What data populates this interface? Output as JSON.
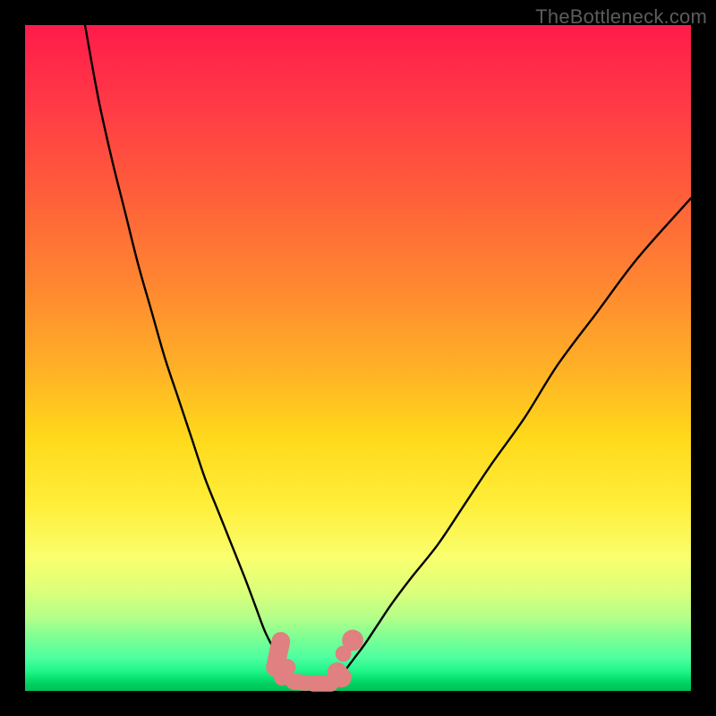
{
  "watermark": "TheBottleneck.com",
  "colors": {
    "frame": "#000000",
    "curve": "#000000",
    "marker_fill": "#e08080",
    "marker_stroke": "#c96a6a"
  },
  "chart_data": {
    "type": "line",
    "title": "",
    "xlabel": "",
    "ylabel": "",
    "xlim": [
      0,
      100
    ],
    "ylim": [
      0,
      100
    ],
    "grid": false,
    "legend": false,
    "series": [
      {
        "name": "left-curve",
        "x": [
          9,
          11,
          13,
          15,
          17,
          19,
          21,
          23,
          25,
          27,
          29,
          31,
          33,
          34.5,
          36,
          37.5,
          39
        ],
        "values": [
          100,
          89,
          80,
          72,
          64,
          57,
          50,
          44,
          38,
          32,
          27,
          22,
          17,
          13,
          9,
          6,
          3
        ]
      },
      {
        "name": "right-curve",
        "x": [
          48,
          49.5,
          51,
          53,
          55,
          58,
          62,
          66,
          70,
          75,
          80,
          86,
          92,
          100
        ],
        "values": [
          3,
          5,
          7,
          10,
          13,
          17,
          22,
          28,
          34,
          41,
          49,
          57,
          65,
          74
        ]
      },
      {
        "name": "bottom-connector",
        "x": [
          38,
          40,
          42,
          44,
          46,
          48
        ],
        "values": [
          2,
          1,
          0.8,
          0.8,
          1,
          2
        ]
      }
    ],
    "markers": [
      {
        "shape": "pill",
        "cx": 38.0,
        "cy": 5.5,
        "w": 2.8,
        "h": 6.8,
        "rot": 12
      },
      {
        "shape": "pill",
        "cx": 39.0,
        "cy": 2.8,
        "w": 2.4,
        "h": 4.2,
        "rot": 28
      },
      {
        "shape": "pill",
        "cx": 41.2,
        "cy": 1.3,
        "w": 4.2,
        "h": 2.4,
        "rot": 6
      },
      {
        "shape": "pill",
        "cx": 44.6,
        "cy": 1.1,
        "w": 5.0,
        "h": 2.4,
        "rot": 0
      },
      {
        "shape": "pill",
        "cx": 47.2,
        "cy": 2.4,
        "w": 3.0,
        "h": 4.0,
        "rot": -40
      },
      {
        "shape": "circle",
        "cx": 47.8,
        "cy": 5.6,
        "r": 1.2
      },
      {
        "shape": "circle",
        "cx": 49.2,
        "cy": 7.6,
        "r": 1.6
      }
    ]
  }
}
